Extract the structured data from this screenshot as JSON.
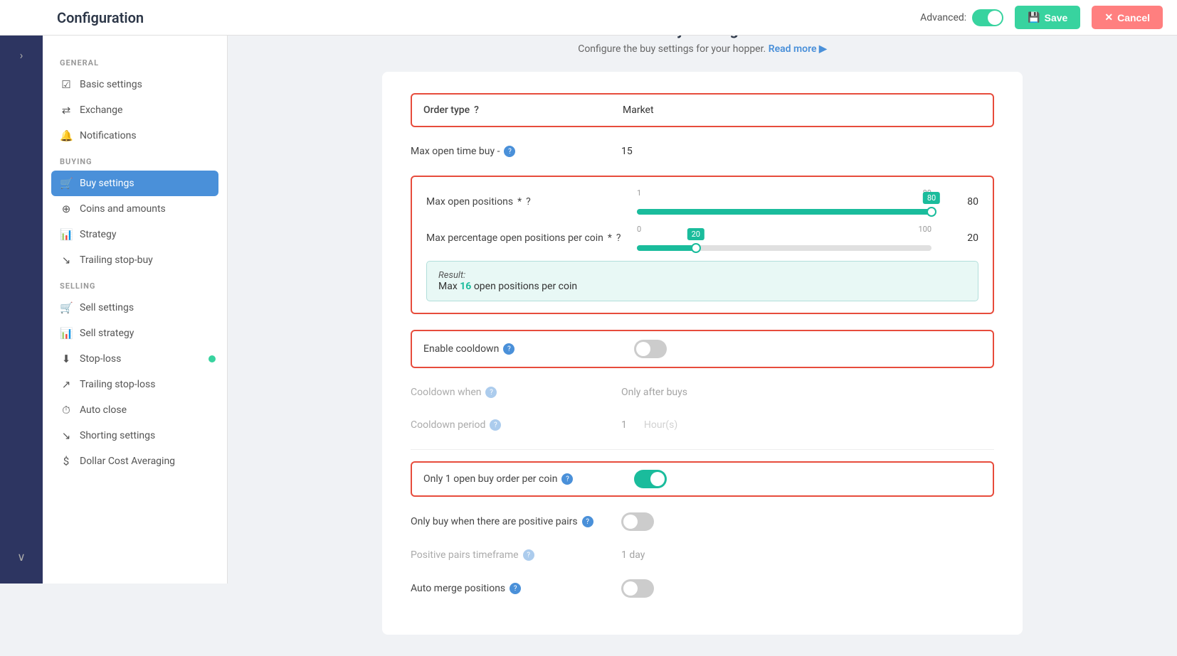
{
  "topbar": {
    "title": "Configuration",
    "advanced_label": "Advanced:",
    "save_label": "Save",
    "cancel_label": "Cancel",
    "save_icon": "💾",
    "cancel_icon": "✕"
  },
  "sidebar": {
    "general_label": "GENERAL",
    "buying_label": "BUYING",
    "selling_label": "SELLING",
    "general_items": [
      {
        "id": "basic-settings",
        "icon": "☑",
        "label": "Basic settings"
      },
      {
        "id": "exchange",
        "icon": "⇄",
        "label": "Exchange"
      },
      {
        "id": "notifications",
        "icon": "🔔",
        "label": "Notifications"
      }
    ],
    "buying_items": [
      {
        "id": "buy-settings",
        "icon": "🛒",
        "label": "Buy settings",
        "active": true
      },
      {
        "id": "coins-amounts",
        "icon": "⊕",
        "label": "Coins and amounts"
      },
      {
        "id": "strategy",
        "icon": "📊",
        "label": "Strategy"
      },
      {
        "id": "trailing-stop-buy",
        "icon": "↘",
        "label": "Trailing stop-buy"
      }
    ],
    "selling_items": [
      {
        "id": "sell-settings",
        "icon": "🛒",
        "label": "Sell settings"
      },
      {
        "id": "sell-strategy",
        "icon": "📊",
        "label": "Sell strategy"
      },
      {
        "id": "stop-loss",
        "icon": "⬇",
        "label": "Stop-loss",
        "dot": true
      },
      {
        "id": "trailing-stop-loss",
        "icon": "↗",
        "label": "Trailing stop-loss"
      },
      {
        "id": "auto-close",
        "icon": "⏱",
        "label": "Auto close"
      },
      {
        "id": "shorting-settings",
        "icon": "↘",
        "label": "Shorting settings"
      },
      {
        "id": "dca",
        "icon": "$",
        "label": "Dollar Cost Averaging"
      }
    ]
  },
  "main": {
    "title": "Buy Settings",
    "subtitle": "Configure the buy settings for your hopper.",
    "read_more": "Read more ▶",
    "order_type_label": "Order type",
    "order_type_value": "Market",
    "max_open_time_buy_label": "Max open time buy -",
    "max_open_time_buy_value": "15",
    "max_open_positions_label": "Max open positions",
    "max_open_positions_value": 80,
    "max_open_positions_min": 1,
    "max_open_positions_max": 80,
    "max_open_positions_fill_pct": 100,
    "max_percentage_label": "Max percentage open positions per coin",
    "max_percentage_value": 20,
    "max_percentage_min": 0,
    "max_percentage_max": 100,
    "max_percentage_fill_pct": 20,
    "result_label": "Result:",
    "result_text_prefix": "Max ",
    "result_value": "16",
    "result_text_suffix": " open positions per coin",
    "enable_cooldown_label": "Enable cooldown",
    "cooldown_when_label": "Cooldown when",
    "cooldown_when_value": "Only after buys",
    "cooldown_period_label": "Cooldown period",
    "cooldown_period_value": "1",
    "cooldown_period_unit": "Hour(s)",
    "only1_label": "Only 1 open buy order per coin",
    "only_positive_pairs_label": "Only buy when there are positive pairs",
    "positive_pairs_timeframe_label": "Positive pairs timeframe",
    "positive_pairs_timeframe_value": "1 day",
    "auto_merge_label": "Auto merge positions"
  }
}
